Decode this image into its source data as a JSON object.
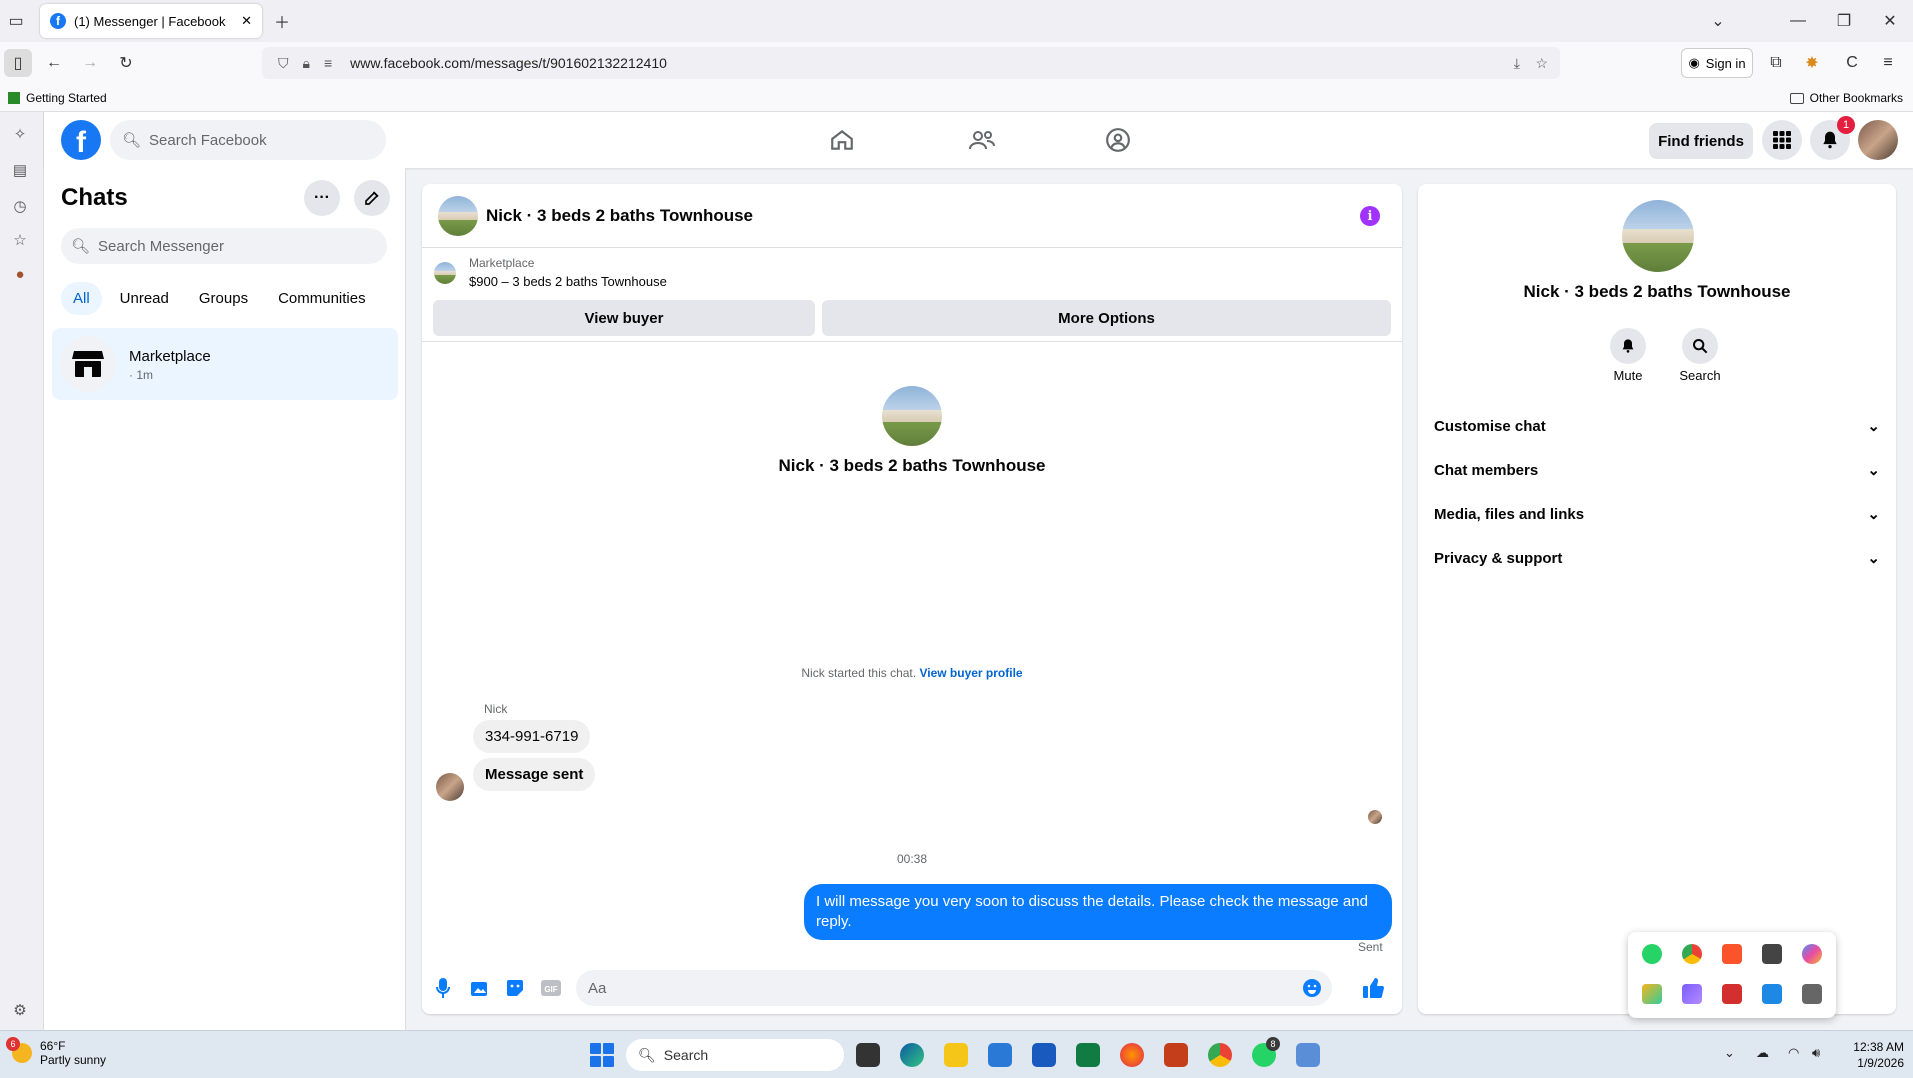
{
  "browser": {
    "tab_title": "(1) Messenger | Facebook",
    "url": "www.facebook.com/messages/t/901602132212410",
    "sign_in": "Sign in",
    "bookmark_left": "Getting Started",
    "bookmark_right": "Other Bookmarks"
  },
  "fb_header": {
    "search_placeholder": "Search Facebook",
    "find_friends": "Find friends",
    "notification_count": "1"
  },
  "chats": {
    "title": "Chats",
    "search_placeholder": "Search Messenger",
    "filters": [
      "All",
      "Unread",
      "Groups",
      "Communities"
    ],
    "items": [
      {
        "name": "Marketplace",
        "meta": "· 1m"
      }
    ]
  },
  "conversation": {
    "title": "Nick · 3 beds 2 baths Townhouse",
    "marketplace_label": "Marketplace",
    "listing": "$900 – 3 beds 2 baths Townhouse",
    "view_buyer": "View buyer",
    "more_options": "More Options",
    "profile_name": "Nick · 3 beds 2 baths Townhouse",
    "started_text": "Nick started this chat.",
    "buyer_profile_link": "View buyer profile",
    "sender_name": "Nick",
    "messages_in": [
      "334-991-6719",
      "Message sent"
    ],
    "timestamp": "00:38",
    "message_out": "I will message you very soon to discuss the details. Please check the message and reply.",
    "status": "Sent",
    "input_placeholder": "Aa"
  },
  "info_panel": {
    "name": "Nick · 3 beds 2 baths Townhouse",
    "actions": [
      "Mute",
      "Search"
    ],
    "sections": [
      "Customise chat",
      "Chat members",
      "Media, files and links",
      "Privacy & support"
    ]
  },
  "taskbar": {
    "temp": "66°F",
    "condition": "Partly sunny",
    "weather_badge": "6",
    "search": "Search",
    "whatsapp_badge": "8",
    "time": "12:38 AM",
    "date": "1/9/2026"
  },
  "colors": {
    "fb_blue": "#1877f2",
    "outgoing_bubble": "#0a7cff",
    "info_purple": "#a033ff"
  }
}
